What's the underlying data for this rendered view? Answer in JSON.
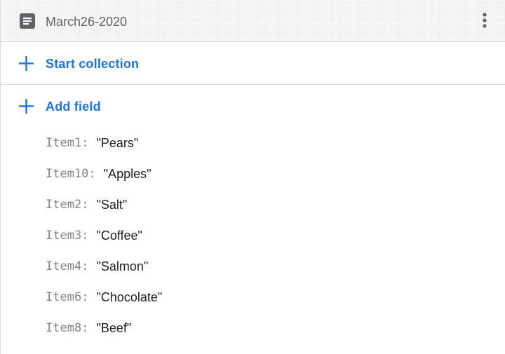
{
  "document": {
    "title": "March26-2020",
    "icon": "document-icon",
    "menu_icon": "more-vert-icon"
  },
  "actions": {
    "start_collection": "Start collection",
    "add_field": "Add field"
  },
  "fields": [
    {
      "key": "Item1",
      "value": "\"Pears\""
    },
    {
      "key": "Item10",
      "value": "\"Apples\""
    },
    {
      "key": "Item2",
      "value": "\"Salt\""
    },
    {
      "key": "Item3",
      "value": "\"Coffee\""
    },
    {
      "key": "Item4",
      "value": "\"Salmon\""
    },
    {
      "key": "Item6",
      "value": "\"Chocolate\""
    },
    {
      "key": "Item8",
      "value": "\"Beef\""
    }
  ],
  "colors": {
    "accent": "#1a73e8",
    "key_text": "#80868b",
    "value_text": "#202124",
    "header_bg": "#f6f6f6"
  }
}
